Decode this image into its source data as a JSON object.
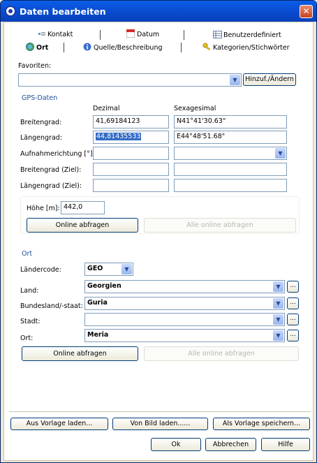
{
  "window": {
    "title": "Daten bearbeiten",
    "close_glyph": "✕"
  },
  "tabs": {
    "row1": [
      {
        "label": "Kontakt",
        "icon": "contact-icon"
      },
      {
        "label": "Datum",
        "icon": "calendar-icon"
      },
      {
        "label": "Benutzerdefiniert",
        "icon": "table-icon"
      }
    ],
    "row2": [
      {
        "label": "Ort",
        "icon": "globe-icon",
        "active": true
      },
      {
        "label": "Quelle/Beschreibung",
        "icon": "info-icon"
      },
      {
        "label": "Kategorien/Stichwörter",
        "icon": "key-icon"
      }
    ]
  },
  "favorites": {
    "label": "Favoriten:",
    "value": "",
    "add_button": "Hinzuf./Ändern"
  },
  "gps": {
    "section_title": "GPS-Daten",
    "col_decimal": "Dezimal",
    "col_sexagesimal": "Sexagesimal",
    "rows": [
      {
        "label": "Breitengrad:",
        "decimal": "41,69184123",
        "sexagesimal": "N41°41'30.63\""
      },
      {
        "label": "Längengrad:",
        "decimal": "44,81435533",
        "sexagesimal": "E44°48'51.68\""
      },
      {
        "label": "Aufnahmerichtung [°]:",
        "decimal": "",
        "sexagesimal": ""
      },
      {
        "label": "Breitengrad (Ziel):",
        "decimal": "",
        "sexagesimal": ""
      },
      {
        "label": "Längengrad (Ziel):",
        "decimal": "",
        "sexagesimal": ""
      }
    ],
    "height_label": "Höhe [m]:",
    "height_value": "442,0",
    "online_button": "Online abfragen",
    "all_online_button": "Alle online abfragen"
  },
  "place": {
    "section_title": "Ort",
    "country_code_label": "Ländercode:",
    "country_code_value": "GEO",
    "rows": [
      {
        "label": "Land:",
        "value": "Georgien"
      },
      {
        "label": "Bundesland/-staat:",
        "value": "Guria"
      },
      {
        "label": "Stadt:",
        "value": ""
      },
      {
        "label": "Ort:",
        "value": "Meria"
      }
    ],
    "ellipsis": "...",
    "online_button": "Online abfragen",
    "all_online_button": "Alle online abfragen"
  },
  "footer": {
    "load_template": "Aus Vorlage laden...",
    "load_from_image": "Von Bild laden......",
    "save_template": "Als Vorlage speichern...",
    "ok": "Ok",
    "cancel": "Abbrechen",
    "help": "Hilfe"
  },
  "colors": {
    "title_bar": "#0a4fd6",
    "section_text": "#1f4fa0",
    "selection": "#316ac5"
  }
}
